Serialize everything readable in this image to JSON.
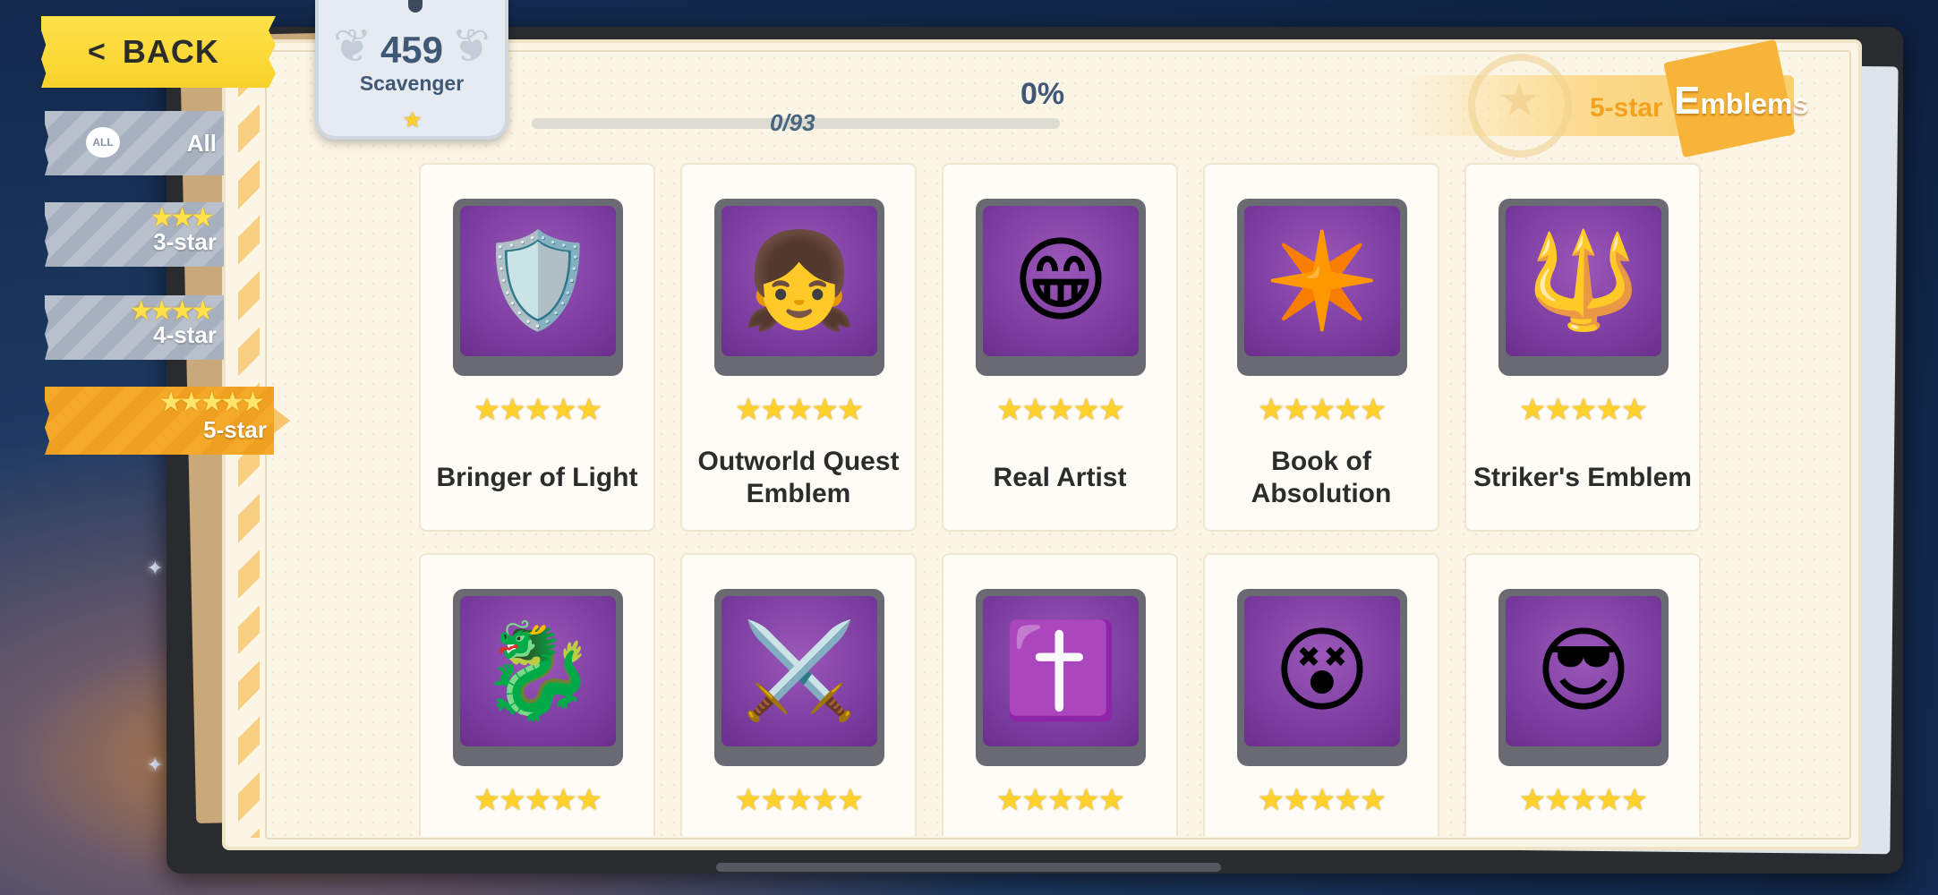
{
  "back_button": {
    "label": "BACK",
    "icon": "chevron-left-icon"
  },
  "filters": [
    {
      "label": "All",
      "icon": "all-icon",
      "stars": "",
      "active": false
    },
    {
      "label": "3-star",
      "stars": "★★★",
      "active": false
    },
    {
      "label": "4-star",
      "stars": "★★★★",
      "active": false
    },
    {
      "label": "5-star",
      "stars": "★★★★★",
      "active": true
    }
  ],
  "score_badge": {
    "value": "459",
    "title": "Scavenger",
    "star": "★"
  },
  "progress": {
    "percent": "0%",
    "count": "0/93",
    "fraction": 0
  },
  "category": {
    "label": "5-star",
    "tag_first": "E",
    "tag_rest": "mblems"
  },
  "cards": [
    {
      "name": "Bringer of Light",
      "stars": "★★★★★",
      "icon": "🛡️"
    },
    {
      "name": "Outworld Quest Emblem",
      "stars": "★★★★★",
      "icon": "👧"
    },
    {
      "name": "Real Artist",
      "stars": "★★★★★",
      "icon": "😁"
    },
    {
      "name": "Book of Absolution",
      "stars": "★★★★★",
      "icon": "✴️"
    },
    {
      "name": "Striker's Emblem",
      "stars": "★★★★★",
      "icon": "🔱"
    },
    {
      "name": "",
      "stars": "★★★★★",
      "icon": "🐉"
    },
    {
      "name": "",
      "stars": "★★★★★",
      "icon": "⚔️"
    },
    {
      "name": "",
      "stars": "★★★★★",
      "icon": "✝️"
    },
    {
      "name": "",
      "stars": "★★★★★",
      "icon": "😵"
    },
    {
      "name": "",
      "stars": "★★★★★",
      "icon": "😎"
    }
  ],
  "colors": {
    "accent_yellow": "#ffe24a",
    "active_tab": "#f5a928",
    "card_bg": "#fefcf6",
    "emblem_bg": "#7d3ea2",
    "text_dark": "#2c2c2c",
    "text_blue": "#3f5875"
  }
}
